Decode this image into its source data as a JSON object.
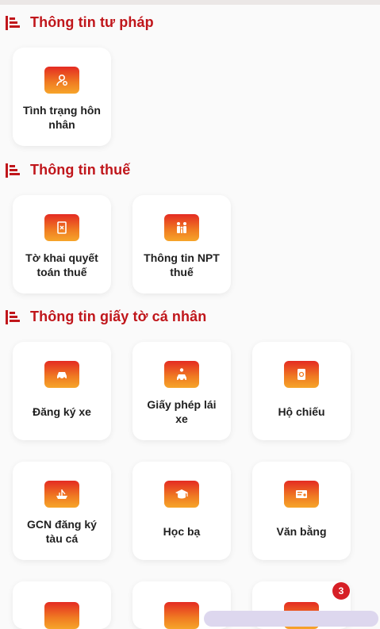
{
  "sections": {
    "legal": {
      "icon": "document-stack-icon",
      "title": "Thông tin tư pháp",
      "items": [
        {
          "label": "Tình trạng hôn nhân",
          "icon": "person-key-icon"
        }
      ]
    },
    "tax": {
      "icon": "document-stack-icon",
      "title": "Thông tin thuế",
      "items": [
        {
          "label": "Tờ khai quyết toán thuế",
          "icon": "tax-document-icon"
        },
        {
          "label": "Thông tin NPT thuế",
          "icon": "family-icon"
        }
      ]
    },
    "personal_docs": {
      "icon": "document-stack-icon",
      "title": "Thông tin giấy tờ cá nhân",
      "items": [
        {
          "label": "Đăng ký xe",
          "icon": "car-icon"
        },
        {
          "label": "Giấy phép lái xe",
          "icon": "driver-license-icon"
        },
        {
          "label": "Hộ chiếu",
          "icon": "passport-icon"
        },
        {
          "label": "GCN đăng ký tàu cá",
          "icon": "fishing-boat-icon"
        },
        {
          "label": "Học bạ",
          "icon": "graduation-cap-icon"
        },
        {
          "label": "Văn bằng",
          "icon": "certificate-icon"
        }
      ]
    }
  },
  "notification_badge": "3",
  "colors": {
    "accent": "#c0161b",
    "tile_gradient_top": "#e42b22",
    "tile_gradient_bottom": "#f6a52a",
    "badge": "#d61f26"
  }
}
